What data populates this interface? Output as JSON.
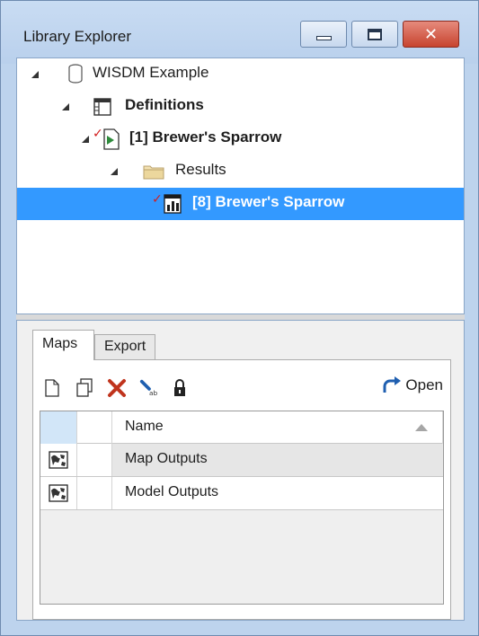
{
  "window": {
    "title": "Library Explorer",
    "caption_buttons": [
      "minimize-icon",
      "maximize-icon",
      "close-icon"
    ]
  },
  "tree": {
    "nodes": [
      {
        "label": "WISDM Example",
        "icon": "database-icon",
        "level": 0,
        "expanded": true,
        "bold": false
      },
      {
        "label": "Definitions",
        "icon": "table-icon",
        "level": 1,
        "expanded": true,
        "bold": true
      },
      {
        "label": "[1] Brewer's Sparrow",
        "icon": "scenario-icon",
        "level": 2,
        "expanded": true,
        "bold": true,
        "checked": true
      },
      {
        "label": "Results",
        "icon": "folder-icon",
        "level": 3,
        "expanded": true,
        "bold": false
      },
      {
        "label": "[8] Brewer's Sparrow",
        "icon": "result-chart-icon",
        "level": 4,
        "expanded": false,
        "bold": true,
        "checked": true,
        "selected": true
      }
    ]
  },
  "tabs": {
    "items": [
      {
        "label": "Maps",
        "active": true
      },
      {
        "label": "Export",
        "active": false
      }
    ]
  },
  "toolbar": {
    "icons": [
      "new-icon",
      "copy-icon",
      "delete-icon",
      "rename-icon",
      "lock-icon"
    ],
    "open_label": "Open"
  },
  "grid": {
    "header": {
      "name": "Name"
    },
    "rows": [
      {
        "name": "Map Outputs",
        "icon": "map-icon"
      },
      {
        "name": "Model Outputs",
        "icon": "map-icon"
      }
    ]
  },
  "colors": {
    "selection": "#3399ff",
    "window_frame": "#bdd3ed",
    "close_button": "#c7442f",
    "delete_x": "#c0341d",
    "check_mark": "#d21f1f",
    "open_arrow": "#1f5fb0"
  }
}
